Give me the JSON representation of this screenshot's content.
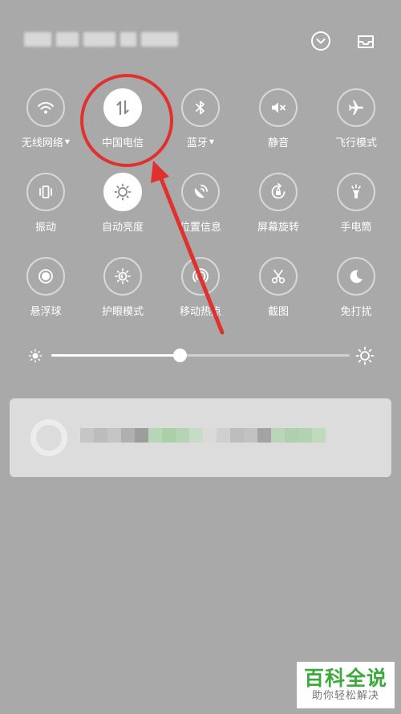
{
  "status_bar": {
    "collapse_icon": "chevron-circle-down-icon",
    "notification_tray_icon": "inbox-tray-icon"
  },
  "tiles": [
    {
      "label": "无线网络",
      "icon": "wifi-icon",
      "caret": "▼",
      "active": false
    },
    {
      "label": "中国电信",
      "icon": "mobile-data-icon",
      "caret": "",
      "active": true
    },
    {
      "label": "蓝牙",
      "icon": "bluetooth-icon",
      "caret": "▼",
      "active": false
    },
    {
      "label": "静音",
      "icon": "mute-icon",
      "caret": "",
      "active": false
    },
    {
      "label": "飞行模式",
      "icon": "airplane-icon",
      "caret": "",
      "active": false
    },
    {
      "label": "振动",
      "icon": "vibrate-icon",
      "caret": "",
      "active": false
    },
    {
      "label": "自动亮度",
      "icon": "auto-brightness-icon",
      "caret": "",
      "active": true
    },
    {
      "label": "位置信息",
      "icon": "location-icon",
      "caret": "",
      "active": false
    },
    {
      "label": "屏幕旋转",
      "icon": "rotation-lock-icon",
      "caret": "",
      "active": false
    },
    {
      "label": "手电筒",
      "icon": "flashlight-icon",
      "caret": "",
      "active": false
    },
    {
      "label": "悬浮球",
      "icon": "floating-ball-icon",
      "caret": "",
      "active": false
    },
    {
      "label": "护眼模式",
      "icon": "eye-care-icon",
      "caret": "",
      "active": false
    },
    {
      "label": "移动热点",
      "icon": "hotspot-icon",
      "caret": "",
      "active": false
    },
    {
      "label": "截图",
      "icon": "screenshot-scissors-icon",
      "caret": "",
      "active": false
    },
    {
      "label": "免打扰",
      "icon": "do-not-disturb-moon-icon",
      "caret": "",
      "active": false
    }
  ],
  "brightness": {
    "level": 0.43,
    "low_icon": "brightness-low-icon",
    "high_icon": "brightness-high-icon"
  },
  "colors": {
    "background": "#a9a9a9",
    "annotation_red": "#e0312f",
    "watermark_green": "#3aab3a"
  },
  "watermark": {
    "title": "百科全说",
    "subtitle": "助你轻松解决"
  }
}
